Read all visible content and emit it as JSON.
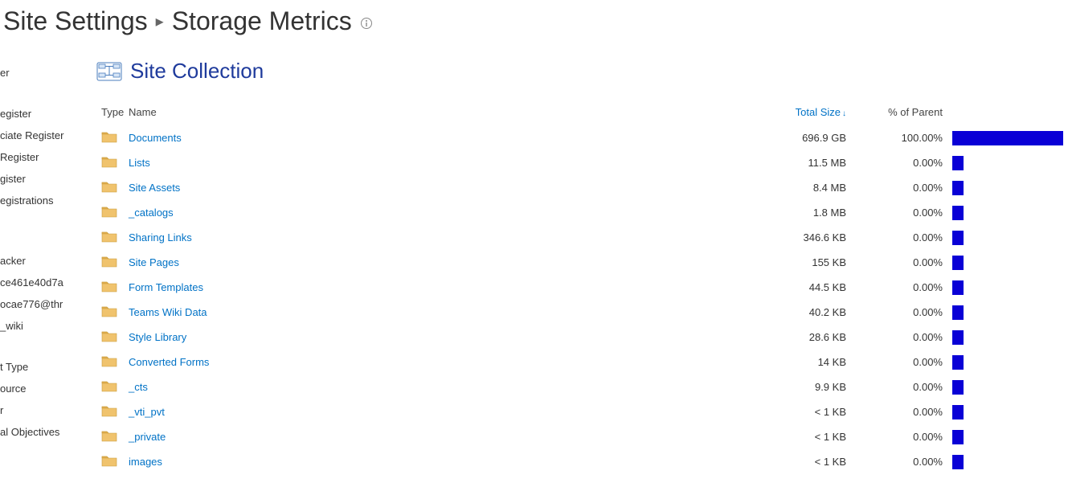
{
  "breadcrumb": {
    "parent": "Site Settings",
    "current": "Storage Metrics"
  },
  "collection": {
    "title": "Site Collection"
  },
  "sidebar": {
    "items": [
      "er",
      "",
      "egister",
      "ciate Register",
      "Register",
      "gister",
      "egistrations",
      "",
      "",
      "acker",
      "ce461e40d7a",
      "ocae776@thr",
      "_wiki",
      "",
      "t Type",
      "ource",
      "r",
      "al Objectives"
    ]
  },
  "columns": {
    "type": "Type",
    "name": "Name",
    "size": "Total Size",
    "percent": "% of Parent"
  },
  "rows": [
    {
      "name": "Documents",
      "size": "696.9 GB",
      "percent": "100.00%",
      "bar": 100
    },
    {
      "name": "Lists",
      "size": "11.5 MB",
      "percent": "0.00%",
      "bar": 10
    },
    {
      "name": "Site Assets",
      "size": "8.4 MB",
      "percent": "0.00%",
      "bar": 10
    },
    {
      "name": "_catalogs",
      "size": "1.8 MB",
      "percent": "0.00%",
      "bar": 10
    },
    {
      "name": "Sharing Links",
      "size": "346.6 KB",
      "percent": "0.00%",
      "bar": 10
    },
    {
      "name": "Site Pages",
      "size": "155 KB",
      "percent": "0.00%",
      "bar": 10
    },
    {
      "name": "Form Templates",
      "size": "44.5 KB",
      "percent": "0.00%",
      "bar": 10
    },
    {
      "name": "Teams Wiki Data",
      "size": "40.2 KB",
      "percent": "0.00%",
      "bar": 10
    },
    {
      "name": "Style Library",
      "size": "28.6 KB",
      "percent": "0.00%",
      "bar": 10
    },
    {
      "name": "Converted Forms",
      "size": "14 KB",
      "percent": "0.00%",
      "bar": 10
    },
    {
      "name": "_cts",
      "size": "9.9 KB",
      "percent": "0.00%",
      "bar": 10
    },
    {
      "name": "_vti_pvt",
      "size": "< 1 KB",
      "percent": "0.00%",
      "bar": 10
    },
    {
      "name": "_private",
      "size": "< 1 KB",
      "percent": "0.00%",
      "bar": 10
    },
    {
      "name": "images",
      "size": "< 1 KB",
      "percent": "0.00%",
      "bar": 10
    }
  ]
}
